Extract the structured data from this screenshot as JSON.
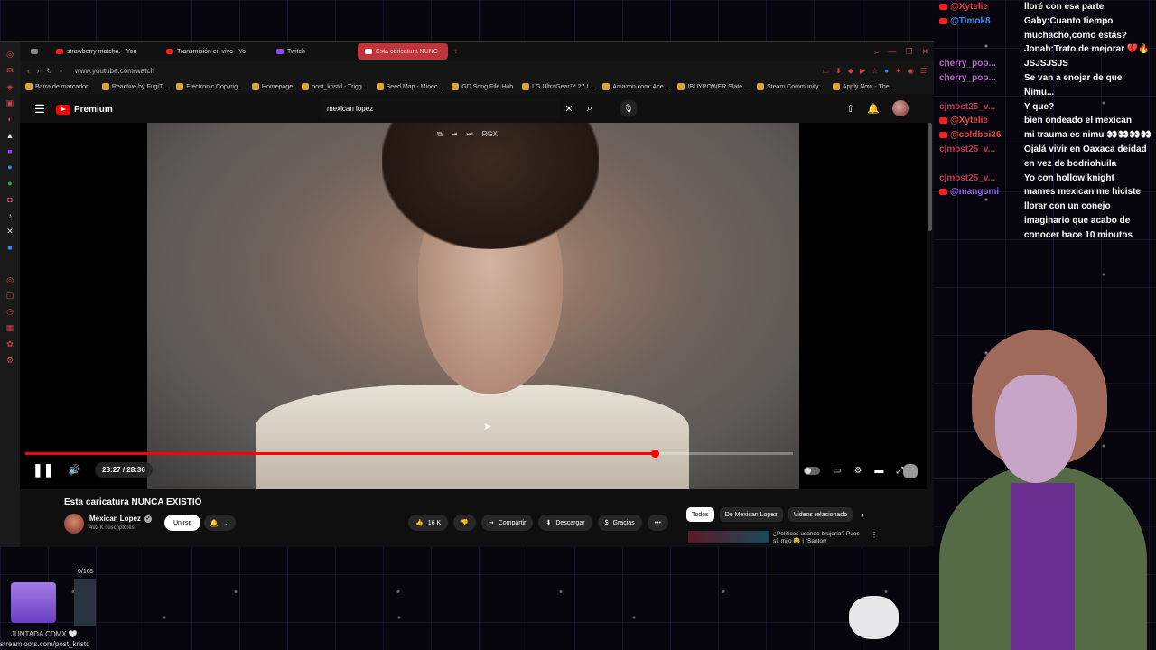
{
  "browser": {
    "tabs": [
      {
        "label": "strawberry matcha. - You",
        "icon": "youtube-icon"
      },
      {
        "label": "Transmisión en vivo - Yo",
        "icon": "youtube-icon"
      },
      {
        "label": "Twitch",
        "icon": "twitch-icon"
      },
      {
        "label": "Esta caricatura NUNC",
        "icon": "youtube-icon",
        "active": true
      }
    ],
    "url": "www.youtube.com/watch",
    "bookmarks": [
      "Barra de marcador...",
      "Reactive by FugiT...",
      "Electronic Copyrig...",
      "Homepage",
      "post_kristd - Trigg...",
      "Seed Map - Minec...",
      "GD Song File Hub",
      "LG UltraGear™ 27 I...",
      "Amazon.com: Ace...",
      "IBUYPOWER Slate...",
      "Steam Community...",
      "Apply Now - The..."
    ]
  },
  "youtube": {
    "brand": "Premium",
    "search_value": "mexican lopez",
    "player": {
      "time": "23:27 / 28:36",
      "progress": 0.82,
      "buffered": 0.86,
      "top_label": "RGX"
    },
    "video": {
      "title": "Esta caricatura NUNCA EXISTIÓ",
      "channel": "Mexican Lopez",
      "subscribers": "492 K suscriptores",
      "join_label": "Unirse",
      "likes": "16 K",
      "share_label": "Compartir",
      "download_label": "Descargar",
      "thanks_label": "Gracias"
    },
    "chips": [
      "Todos",
      "De Mexican Lopez",
      "Videos relacionado"
    ],
    "rec": {
      "title": "¿Políticos usando brujería? Pues sí, mijo 😂 | \"Santorr"
    }
  },
  "chat": [
    {
      "user": "@Xytelie",
      "color": "#e04848",
      "badge": true,
      "text": "lloré con esa parte"
    },
    {
      "user": "@Timok8",
      "color": "#3d8be8",
      "badge": true,
      "text": "Gaby:Cuanto tiempo muchacho,como estás? Jonah:Trato de mejorar 💔🔥"
    },
    {
      "user": "cherry_pop...",
      "color": "#b56bc9",
      "badge": false,
      "text": "JSJSJSJS"
    },
    {
      "user": "cherry_pop...",
      "color": "#b56bc9",
      "badge": false,
      "text": "Se van a enojar de que Nimu..."
    },
    {
      "user": "cjmost25_v...",
      "color": "#c0395a",
      "badge": false,
      "text": "Y que?"
    },
    {
      "user": "@Xytelie",
      "color": "#e04848",
      "badge": true,
      "text": "bien ondeado el mexican"
    },
    {
      "user": "@coldboi36",
      "color": "#e04848",
      "badge": true,
      "text": "mi trauma es nimu 👀👀👀👀"
    },
    {
      "user": "cjmost25_v...",
      "color": "#c0395a",
      "badge": false,
      "text": "Ojalá vivir en Oaxaca deidad en vez de bodriohuila"
    },
    {
      "user": "cjmost25_v...",
      "color": "#c0395a",
      "badge": false,
      "text": "Yo con hollow knight"
    },
    {
      "user": "@mangomi",
      "color": "#8f6be8",
      "badge": true,
      "text": "mames mexican me hiciste llorar con un conejo imaginario que acabo de conocer hace 10 minutos"
    }
  ],
  "overlay": {
    "counter": "0/105",
    "event": "JUNTADA CDMX 🤍",
    "link": "streamloots.com/post_kristd"
  },
  "colors": {
    "accent": "#ff0000",
    "tab_active": "#c0353a",
    "background": "#07060f"
  }
}
